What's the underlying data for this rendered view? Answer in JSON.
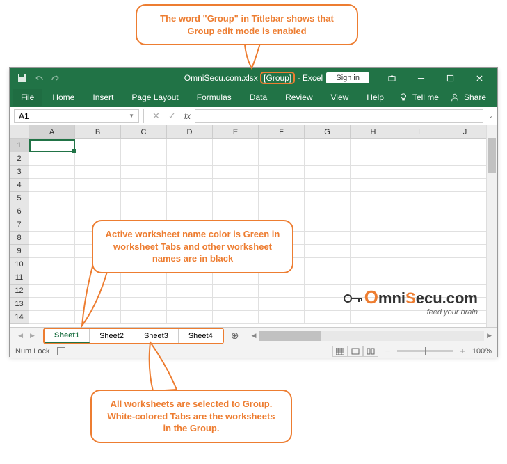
{
  "callouts": {
    "top": "The word \"Group\" in Titlebar shows that Group edit mode is enabled",
    "middle": "Active worksheet name color is Green in worksheet Tabs and other worksheet names are in black",
    "bottom": "All worksheets are selected to Group. White-colored Tabs are the worksheets in the Group."
  },
  "titlebar": {
    "filename": "OmniSecu.com.xlsx",
    "group_label": "[Group]",
    "app_suffix": "- Excel",
    "signin": "Sign in"
  },
  "ribbon": {
    "tabs": [
      "File",
      "Home",
      "Insert",
      "Page Layout",
      "Formulas",
      "Data",
      "Review",
      "View",
      "Help"
    ],
    "tellme": "Tell me",
    "share": "Share"
  },
  "namebox": "A1",
  "fx_label": "fx",
  "columns": [
    "A",
    "B",
    "C",
    "D",
    "E",
    "F",
    "G",
    "H",
    "I",
    "J"
  ],
  "rows": [
    "1",
    "2",
    "3",
    "4",
    "5",
    "6",
    "7",
    "8",
    "9",
    "10",
    "11",
    "12",
    "13",
    "14"
  ],
  "sheets": [
    "Sheet1",
    "Sheet2",
    "Sheet3",
    "Sheet4"
  ],
  "statusbar": {
    "numlock": "Num Lock",
    "zoom": "100%"
  },
  "watermark": {
    "brand_pre": "O",
    "brand_mid": "mni",
    "brand_s": "S",
    "brand_rest": "ecu.com",
    "tag": "feed your brain"
  },
  "add_sheet_symbol": "⊕"
}
